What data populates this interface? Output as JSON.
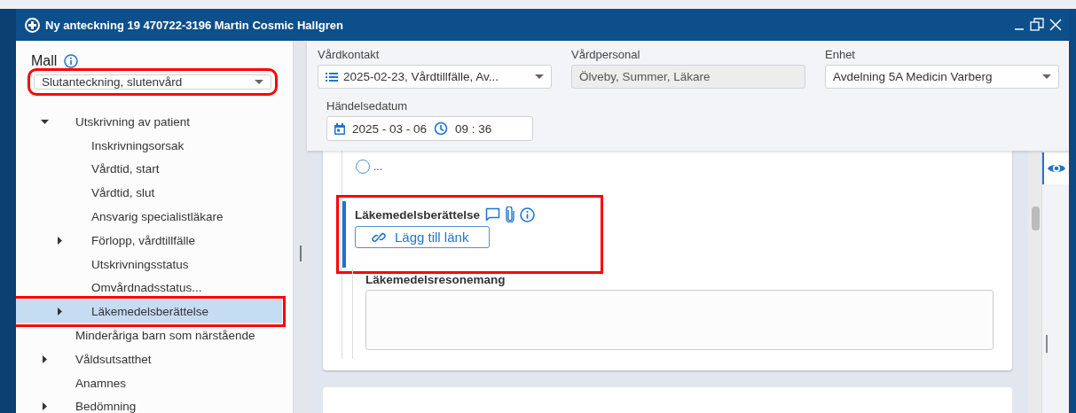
{
  "window": {
    "title": "Ny anteckning 19 470722-3196 Martin Cosmic Hallgren"
  },
  "sidebar": {
    "heading": "Mall",
    "template": {
      "value": "Slutanteckning, slutenvård",
      "highlighted": true
    },
    "tree": [
      {
        "label": "Utskrivning av patient",
        "expanded": true,
        "selected": false,
        "highlighted": false,
        "children": [
          {
            "label": "Inskrivningsorsak",
            "selected": false,
            "highlighted": false
          },
          {
            "label": "Vårdtid, start",
            "selected": false,
            "highlighted": false
          },
          {
            "label": "Vårdtid, slut",
            "selected": false,
            "highlighted": false
          },
          {
            "label": "Ansvarig specialistläkare",
            "selected": false,
            "highlighted": false
          },
          {
            "label": "Förlopp, vårdtillfälle",
            "expanded": false,
            "selected": false,
            "highlighted": false
          },
          {
            "label": "Utskrivningsstatus",
            "selected": false,
            "highlighted": false
          },
          {
            "label": "Omvårdnadsstatus...",
            "selected": false,
            "highlighted": false
          },
          {
            "label": "Läkemedelsberättelse",
            "expanded": false,
            "selected": true,
            "highlighted": true
          }
        ]
      },
      {
        "label": "Minderåriga barn som närstående",
        "selected": false,
        "highlighted": false
      },
      {
        "label": "Våldsutsatthet",
        "expanded": false,
        "selected": false,
        "highlighted": false
      },
      {
        "label": "Anamnes",
        "selected": false,
        "highlighted": false
      },
      {
        "label": "Bedömning",
        "expanded": false,
        "selected": false,
        "highlighted": false
      }
    ]
  },
  "header": {
    "fields": [
      {
        "kind": "list-select",
        "label": "Vårdkontakt",
        "value": "2025-02-23, Vårdtillfälle, Av..."
      },
      {
        "kind": "readonly",
        "label": "Vårdpersonal",
        "value": "Ölveby, Summer, Läkare"
      },
      {
        "kind": "select",
        "label": "Enhet",
        "value": "Avdelning 5A Medicin Varberg"
      }
    ],
    "event": {
      "label": "Händelsedatum",
      "date": "2025 - 03 - 06",
      "time": "09 : 36"
    }
  },
  "form": {
    "radio": {
      "label": "...",
      "selected": false
    },
    "field": {
      "label": "Läkemedelsberättelse",
      "highlighted": true,
      "button": "Lägg till länk"
    },
    "subfield": {
      "label": "Läkemedelsresonemang"
    }
  }
}
